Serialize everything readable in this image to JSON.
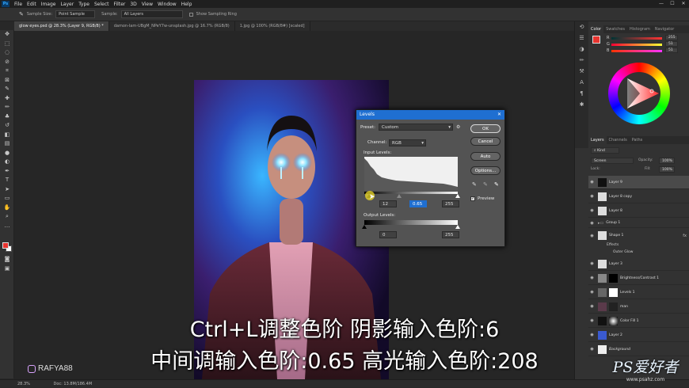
{
  "menubar": {
    "app_icon": "Ps",
    "items": [
      "File",
      "Edit",
      "Image",
      "Layer",
      "Type",
      "Select",
      "Filter",
      "3D",
      "View",
      "Window",
      "Help"
    ]
  },
  "options_bar": {
    "sample_size_label": "Sample Size:",
    "sample_size_value": "Point Sample",
    "sample_label": "Sample:",
    "sample_value": "All Layers",
    "show_ring_label": "Show Sampling Ring"
  },
  "tabs": [
    {
      "label": "glow eyes.psd @ 28.3% (Layer 9, RGB/8) *",
      "active": true
    },
    {
      "label": "damon-lam-UBgM_NPeY7w-unsplash.jpg @ 16.7% (RGB/8)",
      "active": false
    },
    {
      "label": "1.jpg @ 100% (RGB/8#) [scaled]",
      "active": false
    }
  ],
  "levels": {
    "title": "Levels",
    "preset_label": "Preset:",
    "preset_value": "Custom",
    "channel_label": "Channel:",
    "channel_value": "RGB",
    "input_label": "Input Levels:",
    "input_black": "12",
    "input_mid": "0.65",
    "input_white": "255",
    "output_label": "Output Levels:",
    "output_black": "0",
    "output_white": "255",
    "btn_ok": "OK",
    "btn_cancel": "Cancel",
    "btn_auto": "Auto",
    "btn_options": "Options...",
    "preview_label": "Preview",
    "input_black_value": 12,
    "input_gamma_value": 0.65,
    "input_white_value": 255
  },
  "color_panel": {
    "tabs": [
      "Color",
      "Swatches",
      "Histogram",
      "Navigator"
    ],
    "r_value": "255",
    "g_value": "51",
    "b_value": "51",
    "r_label": "R",
    "g_label": "G",
    "b_label": "B",
    "foreground_color": "#e8342f"
  },
  "layers_panel": {
    "tabs": [
      "Layers",
      "Channels",
      "Paths"
    ],
    "kind_label": "Kind",
    "blend_value": "Screen",
    "opacity_label": "Opacity:",
    "opacity_value": "100%",
    "lock_label": "Lock:",
    "fill_label": "Fill:",
    "fill_value": "100%",
    "layers": [
      {
        "name": "Layer 9"
      },
      {
        "name": "Layer 8 copy"
      },
      {
        "name": "Layer 8"
      },
      {
        "name": "Group 1"
      },
      {
        "name": "Shape 1"
      },
      {
        "name": "Effects"
      },
      {
        "name": "Outer Glow"
      },
      {
        "name": "Layer 3"
      },
      {
        "name": "Brightness/Contrast 1"
      },
      {
        "name": "Levels 1"
      },
      {
        "name": "man"
      },
      {
        "name": "Color Fill 1"
      },
      {
        "name": "Layer 2"
      },
      {
        "name": "Background"
      }
    ]
  },
  "statusbar": {
    "zoom": "28.3%",
    "doc": "Doc: 13.8M/186.4M"
  },
  "overlay": {
    "caption_line1": "Ctrl+L调整色阶 阴影输入色阶:6",
    "caption_line2": "中间调输入色阶:0.65 高光输入色阶:208",
    "watermark_handle": "RAFYA88",
    "site_logo": "PS爱好者",
    "site_url": "www.psahz.com"
  },
  "colors": {
    "accent": "#1f6fd1",
    "dialog_bg": "#535353",
    "app_bg": "#282828"
  }
}
